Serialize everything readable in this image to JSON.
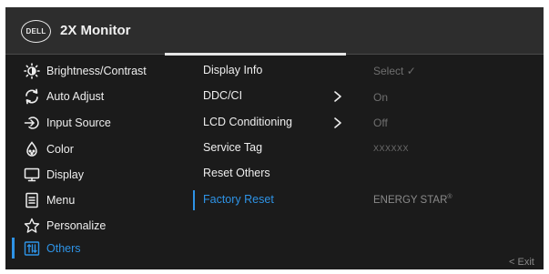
{
  "header": {
    "logo_text": "DELL",
    "title": "2X Monitor"
  },
  "menu": [
    {
      "id": "brightness",
      "label": "Brightness/Contrast",
      "icon": "brightness-icon"
    },
    {
      "id": "auto-adjust",
      "label": "Auto Adjust",
      "icon": "auto-adjust-icon"
    },
    {
      "id": "input-source",
      "label": "Input Source",
      "icon": "input-source-icon"
    },
    {
      "id": "color",
      "label": "Color",
      "icon": "color-palette-icon"
    },
    {
      "id": "display",
      "label": "Display",
      "icon": "display-icon"
    },
    {
      "id": "menu",
      "label": "Menu",
      "icon": "menu-document-icon"
    },
    {
      "id": "personalize",
      "label": "Personalize",
      "icon": "star-icon"
    },
    {
      "id": "others",
      "label": "Others",
      "icon": "others-icon",
      "active": true
    }
  ],
  "submenu": [
    {
      "id": "display-info",
      "label": "Display Info",
      "value": "Select",
      "value_suffix": "✓"
    },
    {
      "id": "ddc-ci",
      "label": "DDC/CI",
      "value": "On",
      "has_arrow": true
    },
    {
      "id": "lcd-conditioning",
      "label": "LCD Conditioning",
      "value": "Off",
      "has_arrow": true
    },
    {
      "id": "service-tag",
      "label": "Service Tag",
      "value": "XXXXXX"
    },
    {
      "id": "reset-others",
      "label": "Reset Others"
    },
    {
      "id": "factory-reset",
      "label": "Factory Reset",
      "value": "ENERGY STAR",
      "value_mark": "®",
      "active": true
    }
  ],
  "footer": {
    "exit_label": "< Exit"
  },
  "colors": {
    "accent": "#2e93e6",
    "background": "#1b1b1b",
    "header": "#2d2d2d",
    "text": "#eeeeee",
    "muted": "#6f6f6f"
  }
}
